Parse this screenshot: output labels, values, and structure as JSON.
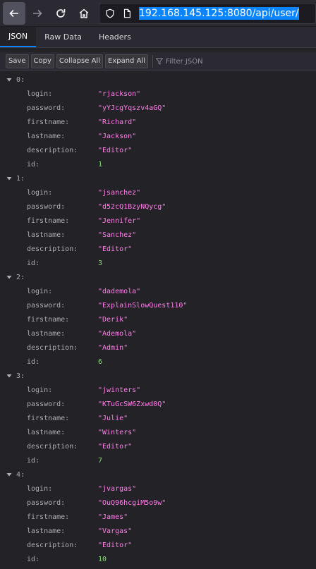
{
  "browser": {
    "url": "192.168.145.125:8080/api/user/"
  },
  "tabs": [
    "JSON",
    "Raw Data",
    "Headers"
  ],
  "actions": [
    "Save",
    "Copy",
    "Collapse All",
    "Expand All"
  ],
  "filter_placeholder": "Filter JSON",
  "field_labels": {
    "login": "login:",
    "password": "password:",
    "firstname": "firstname:",
    "lastname": "lastname:",
    "description": "description:",
    "id": "id:"
  },
  "users": [
    {
      "index": "0:",
      "login": "\"rjackson\"",
      "password": "\"yYJcgYqszv4aGQ\"",
      "firstname": "\"Richard\"",
      "lastname": "\"Jackson\"",
      "description": "\"Editor\"",
      "id": "1"
    },
    {
      "index": "1:",
      "login": "\"jsanchez\"",
      "password": "\"d52cQ1BzyNQycg\"",
      "firstname": "\"Jennifer\"",
      "lastname": "\"Sanchez\"",
      "description": "\"Editor\"",
      "id": "3"
    },
    {
      "index": "2:",
      "login": "\"dademola\"",
      "password": "\"ExplainSlowQuest110\"",
      "firstname": "\"Derik\"",
      "lastname": "\"Ademola\"",
      "description": "\"Admin\"",
      "id": "6"
    },
    {
      "index": "3:",
      "login": "\"jwinters\"",
      "password": "\"KTuGcSW6Zxwd0Q\"",
      "firstname": "\"Julie\"",
      "lastname": "\"Winters\"",
      "description": "\"Editor\"",
      "id": "7"
    },
    {
      "index": "4:",
      "login": "\"jvargas\"",
      "password": "\"OuQ96hcgiM5o9w\"",
      "firstname": "\"James\"",
      "lastname": "\"Vargas\"",
      "description": "\"Editor\"",
      "id": "10"
    }
  ]
}
